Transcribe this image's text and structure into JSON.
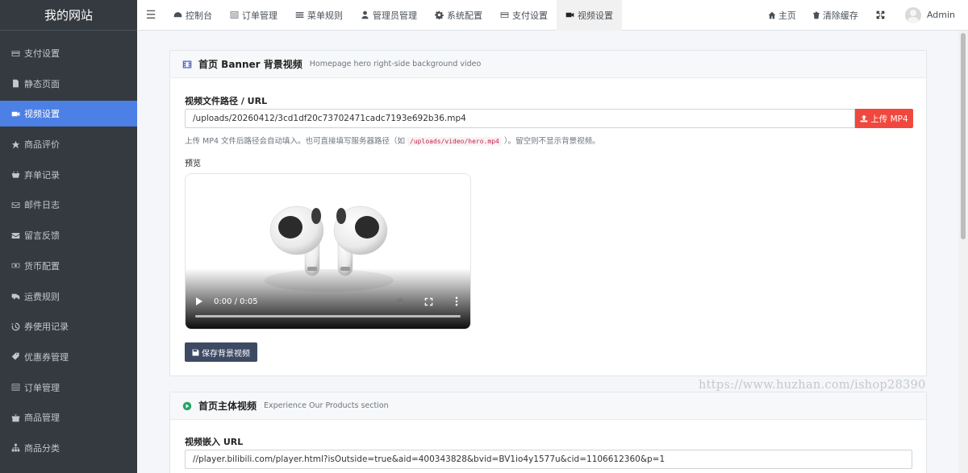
{
  "brand": "我的网站",
  "sidebar": {
    "items": [
      {
        "label": "支付设置",
        "icon": "credit-card-icon"
      },
      {
        "label": "静态页面",
        "icon": "file-icon"
      },
      {
        "label": "视频设置",
        "icon": "video-camera-icon",
        "active": true
      },
      {
        "label": "商品评价",
        "icon": "star-half-icon"
      },
      {
        "label": "弃单记录",
        "icon": "basket-icon"
      },
      {
        "label": "邮件日志",
        "icon": "envelope-icon"
      },
      {
        "label": "留言反馈",
        "icon": "envelope-filled-icon"
      },
      {
        "label": "货币配置",
        "icon": "money-icon"
      },
      {
        "label": "运费规则",
        "icon": "truck-icon"
      },
      {
        "label": "券使用记录",
        "icon": "history-icon"
      },
      {
        "label": "优惠券管理",
        "icon": "ticket-icon"
      },
      {
        "label": "订单管理",
        "icon": "list-alt-icon"
      },
      {
        "label": "商品管理",
        "icon": "gift-icon"
      },
      {
        "label": "商品分类",
        "icon": "sitemap-icon"
      }
    ]
  },
  "topbar": {
    "tabs": [
      {
        "label": "控制台",
        "icon": "dashboard-icon"
      },
      {
        "label": "订单管理",
        "icon": "list-alt-icon"
      },
      {
        "label": "菜单规则",
        "icon": "bars-icon"
      },
      {
        "label": "管理员管理",
        "icon": "user-icon"
      },
      {
        "label": "系统配置",
        "icon": "gear-icon"
      },
      {
        "label": "支付设置",
        "icon": "credit-card-icon"
      },
      {
        "label": "视频设置",
        "icon": "video-camera-icon",
        "active": true
      }
    ],
    "home": "主页",
    "clear_cache": "清除缓存",
    "user": "Admin"
  },
  "banner_card": {
    "title": "首页 Banner 背景视频",
    "subtitle": "Homepage hero right-side background video",
    "field_label": "视频文件路径 / URL",
    "field_value": "/uploads/20260412/3cd1df20c73702471cadc7193e692b36.mp4",
    "upload_button": "上传 MP4",
    "help_before": "上传 MP4 文件后路径会自动填入。也可直接填写服务器路径（如",
    "help_code": "/uploads/video/hero.mp4",
    "help_after": "）。留空则不显示背景视频。",
    "preview_label": "预览",
    "video_time": "0:00 / 0:05",
    "save_button": "保存背景视频"
  },
  "products_card": {
    "title": "首页主体视频",
    "subtitle": "Experience Our Products section",
    "field_label": "视频嵌入 URL",
    "field_value": "//player.bilibili.com/player.html?isOutside=true&aid=400343828&bvid=BV1io4y1577u&cid=1106612360&p=1"
  },
  "watermark": "https://www.huzhan.com/ishop28390",
  "colors": {
    "sidebar_bg": "#343a40",
    "active_nav": "#4d80e4",
    "upload_button": "#f0483e",
    "save_button": "#3d4a64"
  }
}
